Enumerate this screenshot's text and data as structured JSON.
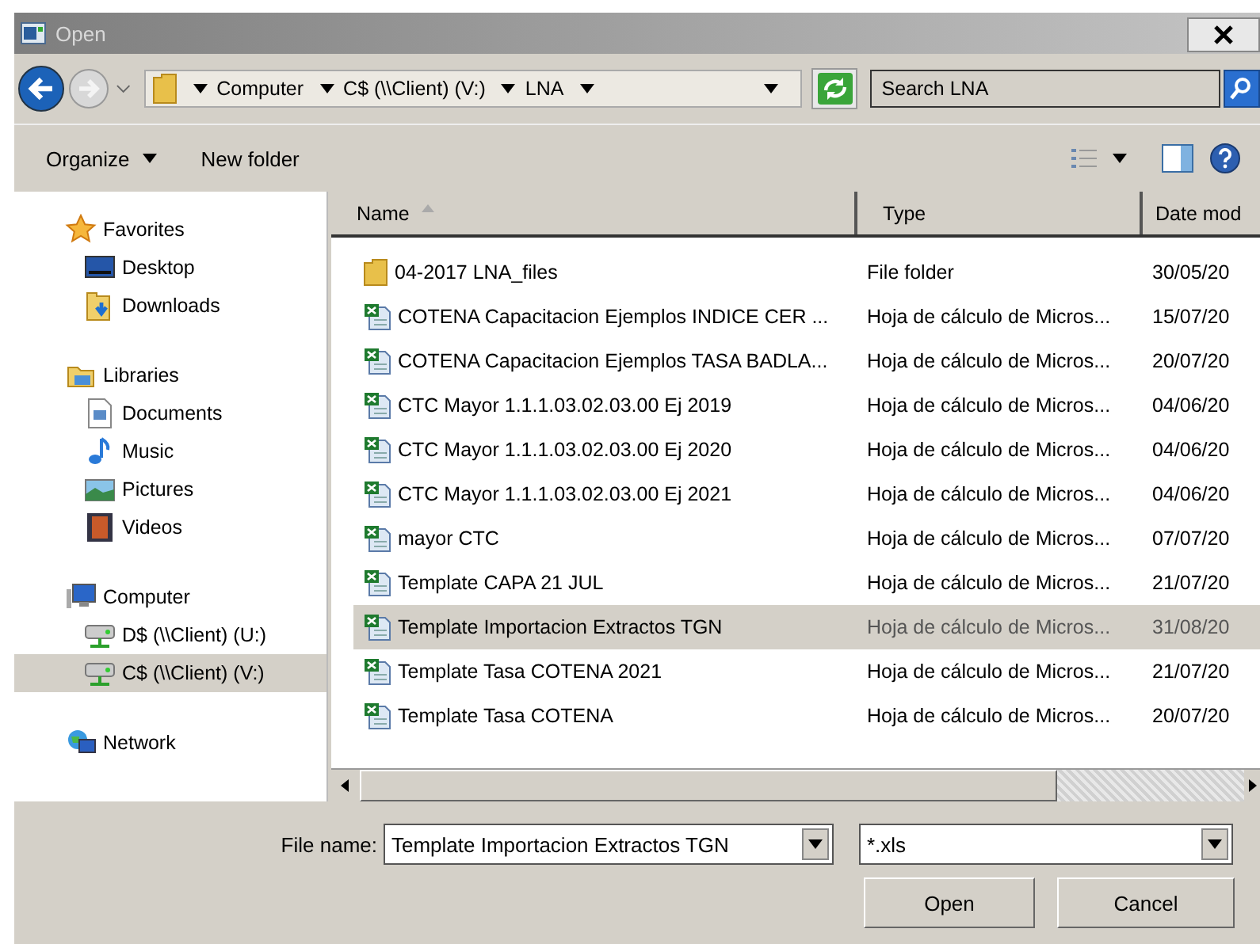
{
  "window": {
    "title": "Open"
  },
  "nav": [
    {
      "kind": "back",
      "disabled": false
    },
    {
      "kind": "forward",
      "disabled": true
    }
  ],
  "breadcrumb": [
    "Computer",
    "C$ (\\\\Client) (V:)",
    "LNA"
  ],
  "search": {
    "placeholder": "Search LNA"
  },
  "toolbar": {
    "organize": "Organize",
    "new_folder": "New folder"
  },
  "sidebar": {
    "groups": [
      {
        "label": "Favorites",
        "kind": "star",
        "selected": false,
        "children": [
          {
            "label": "Desktop",
            "kind": "desktop",
            "selected": false
          },
          {
            "label": "Downloads",
            "kind": "download",
            "selected": false
          }
        ]
      },
      {
        "label": "Libraries",
        "kind": "library",
        "selected": false,
        "children": [
          {
            "label": "Documents",
            "kind": "document",
            "selected": false
          },
          {
            "label": "Music",
            "kind": "music",
            "selected": false
          },
          {
            "label": "Pictures",
            "kind": "picture",
            "selected": false
          },
          {
            "label": "Videos",
            "kind": "video",
            "selected": false
          }
        ]
      },
      {
        "label": "Computer",
        "kind": "computer",
        "selected": false,
        "children": [
          {
            "label": "D$ (\\\\Client) (U:)",
            "kind": "drive",
            "selected": false
          },
          {
            "label": "C$ (\\\\Client) (V:)",
            "kind": "drive",
            "selected": true
          }
        ]
      },
      {
        "label": "Network",
        "kind": "network",
        "selected": false
      }
    ]
  },
  "table": {
    "columns": [
      "Name",
      "Type",
      "Date mod"
    ],
    "rows": [
      {
        "name": "04-2017 LNA_files",
        "type": "File folder",
        "date": "30/05/20",
        "kind": "folder",
        "selected": false
      },
      {
        "name": "COTENA Capacitacion Ejemplos INDICE CER ...",
        "type": "Hoja de cálculo de Micros...",
        "date": "15/07/20",
        "kind": "sheet",
        "selected": false
      },
      {
        "name": "COTENA Capacitacion Ejemplos TASA BADLA...",
        "type": "Hoja de cálculo de Micros...",
        "date": "20/07/20",
        "kind": "sheet",
        "selected": false
      },
      {
        "name": "CTC Mayor 1.1.1.03.02.03.00 Ej 2019",
        "type": "Hoja de cálculo de Micros...",
        "date": "04/06/20",
        "kind": "sheet",
        "selected": false
      },
      {
        "name": "CTC Mayor 1.1.1.03.02.03.00 Ej 2020",
        "type": "Hoja de cálculo de Micros...",
        "date": "04/06/20",
        "kind": "sheet",
        "selected": false
      },
      {
        "name": "CTC Mayor 1.1.1.03.02.03.00 Ej 2021",
        "type": "Hoja de cálculo de Micros...",
        "date": "04/06/20",
        "kind": "sheet",
        "selected": false
      },
      {
        "name": "mayor CTC",
        "type": "Hoja de cálculo de Micros...",
        "date": "07/07/20",
        "kind": "sheet",
        "selected": false
      },
      {
        "name": "Template CAPA 21 JUL",
        "type": "Hoja de cálculo de Micros...",
        "date": "21/07/20",
        "kind": "sheet",
        "selected": false
      },
      {
        "name": "Template Importacion Extractos TGN",
        "type": "Hoja de cálculo de Micros...",
        "date": "31/08/20",
        "kind": "sheet",
        "selected": true
      },
      {
        "name": "Template Tasa COTENA 2021",
        "type": "Hoja de cálculo de Micros...",
        "date": "21/07/20",
        "kind": "sheet",
        "selected": false
      },
      {
        "name": "Template Tasa COTENA",
        "type": "Hoja de cálculo de Micros...",
        "date": "20/07/20",
        "kind": "sheet",
        "selected": false
      }
    ]
  },
  "footer": {
    "file_name_label": "File name:",
    "file_name": "Template Importacion Extractos TGN",
    "filter": "*.xls",
    "buttons": [
      "Open",
      "Cancel"
    ]
  }
}
